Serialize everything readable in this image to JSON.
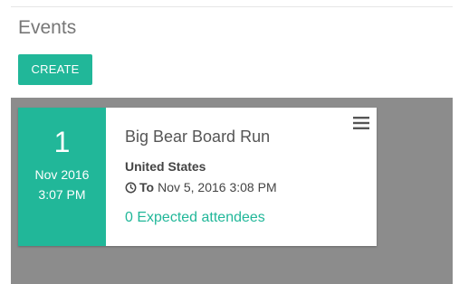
{
  "header": {
    "title": "Events",
    "create_label": "CREATE"
  },
  "event_card": {
    "day": "1",
    "month_year": "Nov 2016",
    "time": "3:07 PM",
    "name": "Big Bear Board Run",
    "country": "United States",
    "to_label": "To",
    "to_value": "Nov 5, 2016 3:08 PM",
    "attendees": "0 Expected attendees"
  },
  "icons": {
    "clock": "clock-icon",
    "menu": "hamburger-menu-icon"
  },
  "colors": {
    "accent": "#21b799",
    "kanban_background": "#8c8c8c",
    "title_text": "#777777"
  }
}
